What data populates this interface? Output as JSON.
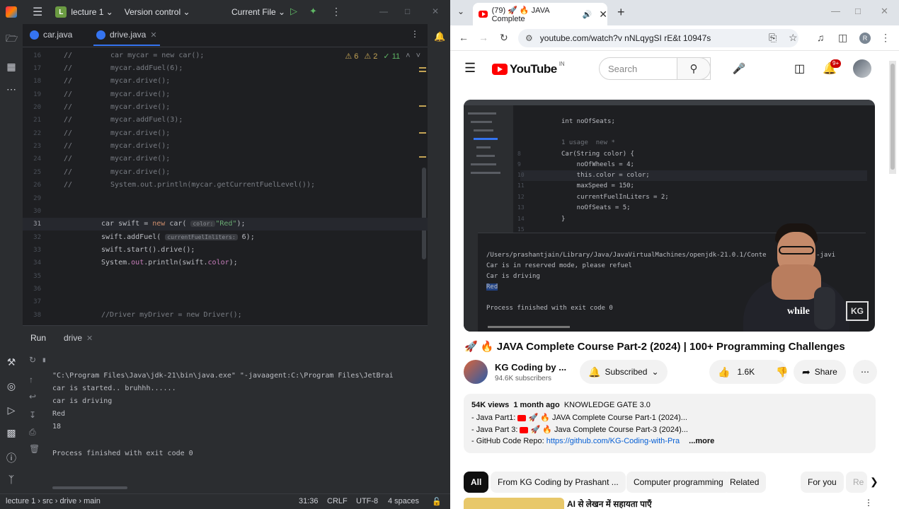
{
  "ide": {
    "project": "lecture 1",
    "project_badge": "L",
    "version_control": "Version control",
    "run_config": "Current File",
    "tabs": [
      {
        "label": "car.java"
      },
      {
        "label": "drive.java"
      }
    ],
    "inspections": {
      "warnings": "6",
      "weak_warnings": "2",
      "checks": "11"
    },
    "code_lines": [
      {
        "n": "16",
        "comment": "//",
        "text": "car mycar = new car();"
      },
      {
        "n": "17",
        "comment": "//",
        "text": "mycar.addFuel(6);"
      },
      {
        "n": "18",
        "comment": "//",
        "text": "mycar.drive();"
      },
      {
        "n": "19",
        "comment": "//",
        "text": "mycar.drive();"
      },
      {
        "n": "20",
        "comment": "//",
        "text": "mycar.drive();"
      },
      {
        "n": "21",
        "comment": "//",
        "text": "mycar.addFuel(3);"
      },
      {
        "n": "22",
        "comment": "//",
        "text": "mycar.drive();"
      },
      {
        "n": "23",
        "comment": "//",
        "text": "mycar.drive();"
      },
      {
        "n": "24",
        "comment": "//",
        "text": "mycar.drive();"
      },
      {
        "n": "25",
        "comment": "//",
        "text": "mycar.drive();"
      },
      {
        "n": "26",
        "comment": "//",
        "text": "System.out.println(mycar.getCurrentFuelLevel());"
      },
      {
        "n": "29",
        "comment": "",
        "text": ""
      },
      {
        "n": "30",
        "comment": "",
        "text": ""
      },
      {
        "n": "31",
        "comment": "",
        "text": ""
      },
      {
        "n": "32",
        "comment": "",
        "text": ""
      },
      {
        "n": "33",
        "comment": "",
        "text": ""
      },
      {
        "n": "34",
        "comment": "",
        "text": ""
      },
      {
        "n": "35",
        "comment": "",
        "text": ""
      },
      {
        "n": "36",
        "comment": "",
        "text": ""
      },
      {
        "n": "37",
        "comment": "",
        "text": ""
      },
      {
        "n": "38",
        "comment": "",
        "text": "//Driver myDriver = new Driver();"
      }
    ],
    "line31": {
      "pre": "car swift = ",
      "kw": "new",
      "mid": " car( ",
      "hint": "color:",
      "str": "\"Red\"",
      "post": ");"
    },
    "line32": {
      "pre": "swift.addFuel( ",
      "hint": "currentFuelInliters:",
      "post": " 6);"
    },
    "line33": {
      "text": "swift.start().drive();"
    },
    "line34": {
      "pre": "System.",
      "fld1": "out",
      "mid": ".println(swift.",
      "fld2": "color",
      "post": ");"
    },
    "run_panel": {
      "title": "Run",
      "config": "drive",
      "output": [
        "\"C:\\Program Files\\Java\\jdk-21\\bin\\java.exe\" \"-javaagent:C:\\Program Files\\JetBrai",
        "car is started.. bruhhh......",
        "car is driving",
        "Red",
        "18",
        "",
        "Process finished with exit code 0"
      ]
    },
    "statusbar": {
      "path": [
        "lecture 1",
        "src",
        "drive",
        "main"
      ],
      "position": "31:36",
      "line_sep": "CRLF",
      "encoding": "UTF-8",
      "indent": "4 spaces"
    }
  },
  "browser": {
    "tab_title": "(79) 🚀 🔥 JAVA Complete",
    "url": "youtube.com/watch?v  nNLqygSI rE&t  10947s",
    "profile_initial": "R",
    "youtube": {
      "logo": "YouTube",
      "country": "IN",
      "search_placeholder": "Search",
      "notif_count": "9+",
      "video_title": "🚀 🔥 JAVA Complete Course Part-2 (2024) | 100+ Programming Challenges",
      "channel_name": "KG Coding by ...",
      "subscribers": "94.6K subscribers",
      "subscribe_label": "Subscribed",
      "likes": "1.6K",
      "share_label": "Share",
      "views": "54K views",
      "age": "1 month ago",
      "tag": "KNOWLEDGE GATE 3.0",
      "desc_lines": [
        {
          "prefix": "- Java Part1:",
          "title": "🚀 🔥 JAVA Complete Course Part-1 (2024)..."
        },
        {
          "prefix": "- Java Part 3:",
          "title": "🚀 🔥 Java Complete Course Part-3 (2024)..."
        }
      ],
      "repo_prefix": "- GitHub Code Repo:",
      "repo_link": "https://github.com/KG-Coding-with-Pra",
      "more_label": "...more",
      "chips": [
        "All",
        "From KG Coding by Prashant ...",
        "Computer programming",
        "Related",
        "For you",
        "Re"
      ],
      "next_video_title": "AI से लेखन में सहायता पाएँ",
      "player": {
        "code": [
          {
            "n": "",
            "text": "int noOfSeats;"
          },
          {
            "n": "",
            "text": "1 usage  new *"
          },
          {
            "n": "8",
            "text": "Car(String color) {"
          },
          {
            "n": "9",
            "text": "    noOfWheels = 4;"
          },
          {
            "n": "10",
            "text": "    this.color = color;"
          },
          {
            "n": "11",
            "text": "    maxSpeed = 150;"
          },
          {
            "n": "12",
            "text": "    currentFuelInLiters = 2;"
          },
          {
            "n": "13",
            "text": "    noOfSeats = 5;"
          },
          {
            "n": "14",
            "text": "}"
          },
          {
            "n": "15",
            "text": ""
          }
        ],
        "console": [
          "/Users/prashantjain/Library/Java/JavaVirtualMachines/openjdk-21.0.1/Conte      h/java -javi",
          "Car is in reserved mode, please refuel",
          "Car is driving",
          "Red",
          "",
          "Process finished with exit code 0"
        ],
        "shirt_text": "while",
        "watermark": "KG"
      }
    }
  }
}
